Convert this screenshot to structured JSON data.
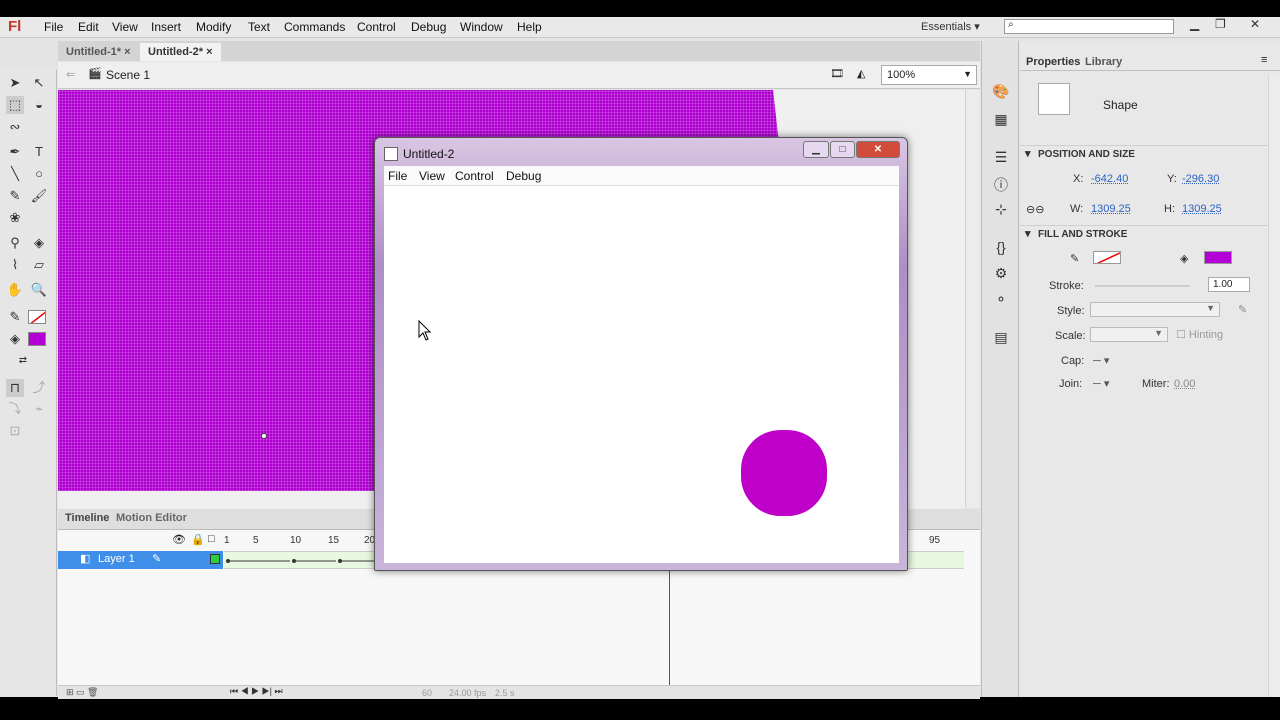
{
  "app": {
    "logo": "Fl",
    "menu": [
      "File",
      "Edit",
      "View",
      "Insert",
      "Modify",
      "Text",
      "Commands",
      "Control",
      "Debug",
      "Window",
      "Help"
    ],
    "workspace": "Essentials",
    "search_placeholder": ""
  },
  "tabs": [
    "Untitled-1*",
    "Untitled-2*"
  ],
  "editbar": {
    "scene": "Scene 1",
    "zoom": "100%"
  },
  "stage": {
    "color": "#b000d0"
  },
  "timeline": {
    "tabs": [
      "Timeline",
      "Motion Editor"
    ],
    "layer": "Layer 1",
    "frame_numbers": [
      "1",
      "5",
      "10",
      "15",
      "20",
      "95"
    ],
    "status": {
      "frame": "60",
      "fps": "24.00 fps",
      "time": "2.5 s"
    }
  },
  "properties": {
    "tabs": [
      "Properties",
      "Library"
    ],
    "type": "Shape",
    "position_section": "POSITION AND SIZE",
    "x_label": "X:",
    "x": "-642.40",
    "y_label": "Y:",
    "y": "-296.30",
    "w_label": "W:",
    "w": "1309.25",
    "h_label": "H:",
    "h": "1309.25",
    "fill_section": "FILL AND STROKE",
    "fill_color": "#b300d6",
    "stroke_label": "Stroke:",
    "stroke": "1.00",
    "style_label": "Style:",
    "scale_label": "Scale:",
    "hinting": "Hinting",
    "cap_label": "Cap:",
    "join_label": "Join:",
    "miter_label": "Miter:",
    "miter": "0.00"
  },
  "preview_window": {
    "title": "Untitled-2",
    "menu": [
      "File",
      "View",
      "Control",
      "Debug"
    ],
    "ball_color": "#bf00c8"
  }
}
